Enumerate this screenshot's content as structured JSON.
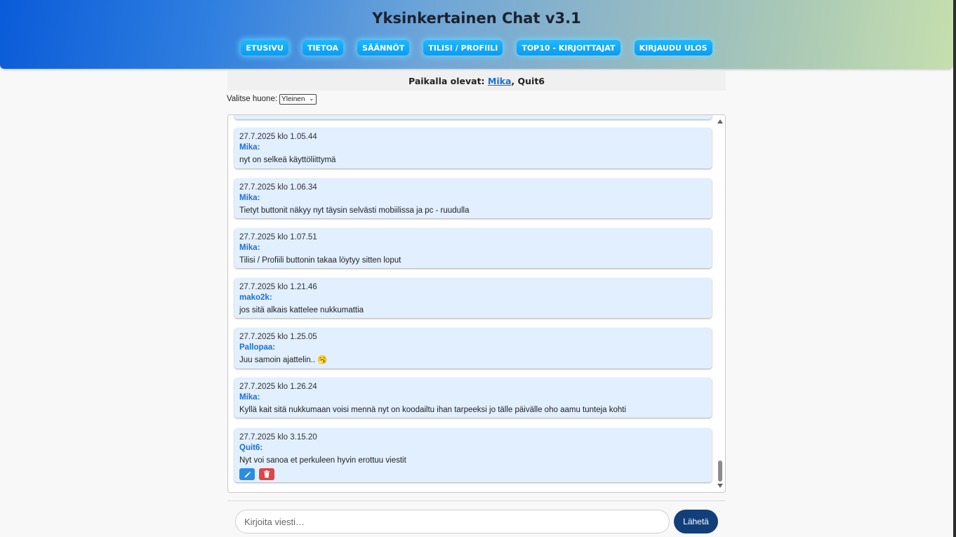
{
  "header": {
    "title": "Yksinkertainen Chat v3.1",
    "nav": [
      "ETUSIVU",
      "TIETOA",
      "SÄÄNNÖT",
      "TILISI / PROFIILI",
      "TOP10 - KIRJOITTAJAT",
      "KIRJAUDU ULOS"
    ]
  },
  "online": {
    "label": "Paikalla olevat:",
    "user_link": "Mika",
    "others": ", Quit6"
  },
  "room": {
    "label": "Valitse huone:",
    "selected": "Yleinen"
  },
  "messages": [
    {
      "time": "27.7.2025 klo 1.05.44",
      "user": "Mika:",
      "text": "nyt on selkeä käyttöliittymä"
    },
    {
      "time": "27.7.2025 klo 1.06.34",
      "user": "Mika:",
      "text": "Tietyt buttonit näkyy nyt täysin selvästi mobiilissa ja pc - ruudulla"
    },
    {
      "time": "27.7.2025 klo 1.07.51",
      "user": "Mika:",
      "text": "Tilisi / Profiili buttonin takaa löytyy sitten loput"
    },
    {
      "time": "27.7.2025 klo 1.21.46",
      "user": "mako2k:",
      "text": "jos sitä alkais kattelee nukkumattia"
    },
    {
      "time": "27.7.2025 klo 1.25.05",
      "user": "Pallopaa:",
      "text": "Juu samoin ajattelin.. 🥱"
    },
    {
      "time": "27.7.2025 klo 1.26.24",
      "user": "Mika:",
      "text": "Kyllä kait sitä nukkumaan voisi mennä nyt on koodailtu ihan tarpeeksi jo tälle päivälle oho aamu tunteja kohti"
    },
    {
      "time": "27.7.2025 klo 3.15.20",
      "user": "Quit6:",
      "text": "Nyt voi sanoa et perkuleen hyvin erottuu viestit"
    }
  ],
  "composer": {
    "placeholder": "Kirjoita viesti…",
    "send_label": "Lähetä"
  },
  "colors": {
    "nav_button": "#0a9cf2",
    "username": "#1a6fd6",
    "message_bg": "#e1efff",
    "send_button": "#123f7a",
    "edit_button": "#2b8ddf",
    "delete_button": "#e04444"
  }
}
